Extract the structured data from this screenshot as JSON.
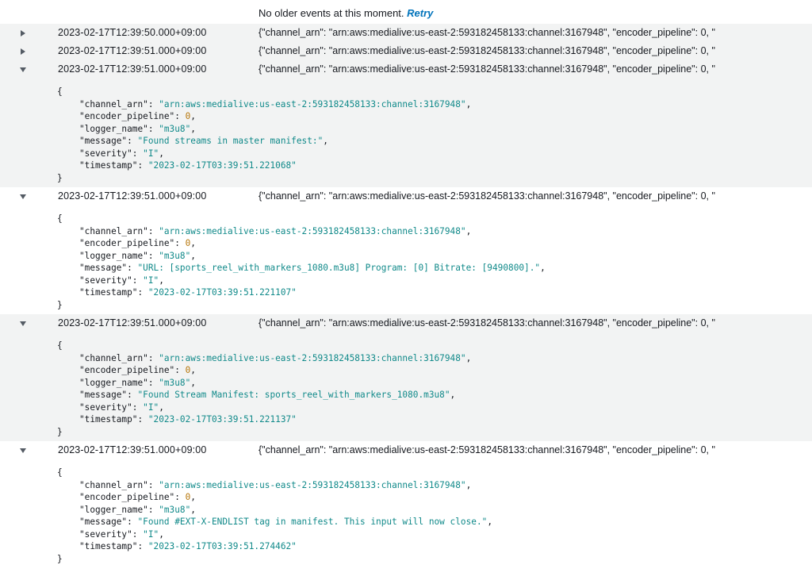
{
  "notice": {
    "text": "No older events at this moment.",
    "retry_label": "Retry"
  },
  "colors": {
    "row_alt_bg": "#f2f3f3",
    "string_value": "#118a8a",
    "number_value": "#b7770b",
    "link": "#0073bb"
  },
  "icons": {
    "collapsed": "caret-right-icon",
    "expanded": "caret-down-icon"
  },
  "events": [
    {
      "timestamp": "2023-02-17T12:39:50.000+09:00",
      "message": "{\"channel_arn\": \"arn:aws:medialive:us-east-2:593182458133:channel:3167948\", \"encoder_pipeline\": 0, \"",
      "expanded": false
    },
    {
      "timestamp": "2023-02-17T12:39:51.000+09:00",
      "message": "{\"channel_arn\": \"arn:aws:medialive:us-east-2:593182458133:channel:3167948\", \"encoder_pipeline\": 0, \"",
      "expanded": false
    },
    {
      "timestamp": "2023-02-17T12:39:51.000+09:00",
      "message": "{\"channel_arn\": \"arn:aws:medialive:us-east-2:593182458133:channel:3167948\", \"encoder_pipeline\": 0, \"",
      "expanded": true,
      "json": {
        "open": "{",
        "close": "}",
        "fields": [
          {
            "key": "\"channel_arn\"",
            "value": "\"arn:aws:medialive:us-east-2:593182458133:channel:3167948\"",
            "type": "string"
          },
          {
            "key": "\"encoder_pipeline\"",
            "value": "0",
            "type": "number"
          },
          {
            "key": "\"logger_name\"",
            "value": "\"m3u8\"",
            "type": "string"
          },
          {
            "key": "\"message\"",
            "value": "\"Found streams in master manifest:\"",
            "type": "string"
          },
          {
            "key": "\"severity\"",
            "value": "\"I\"",
            "type": "string"
          },
          {
            "key": "\"timestamp\"",
            "value": "\"2023-02-17T03:39:51.221068\"",
            "type": "string",
            "last": true
          }
        ]
      }
    },
    {
      "timestamp": "2023-02-17T12:39:51.000+09:00",
      "message": "{\"channel_arn\": \"arn:aws:medialive:us-east-2:593182458133:channel:3167948\", \"encoder_pipeline\": 0, \"",
      "expanded": true,
      "json": {
        "open": "{",
        "close": "}",
        "fields": [
          {
            "key": "\"channel_arn\"",
            "value": "\"arn:aws:medialive:us-east-2:593182458133:channel:3167948\"",
            "type": "string"
          },
          {
            "key": "\"encoder_pipeline\"",
            "value": "0",
            "type": "number"
          },
          {
            "key": "\"logger_name\"",
            "value": "\"m3u8\"",
            "type": "string"
          },
          {
            "key": "\"message\"",
            "value": "\"URL: [sports_reel_with_markers_1080.m3u8] Program: [0] Bitrate: [9490800].\"",
            "type": "string"
          },
          {
            "key": "\"severity\"",
            "value": "\"I\"",
            "type": "string"
          },
          {
            "key": "\"timestamp\"",
            "value": "\"2023-02-17T03:39:51.221107\"",
            "type": "string",
            "last": true
          }
        ]
      }
    },
    {
      "timestamp": "2023-02-17T12:39:51.000+09:00",
      "message": "{\"channel_arn\": \"arn:aws:medialive:us-east-2:593182458133:channel:3167948\", \"encoder_pipeline\": 0, \"",
      "expanded": true,
      "json": {
        "open": "{",
        "close": "}",
        "fields": [
          {
            "key": "\"channel_arn\"",
            "value": "\"arn:aws:medialive:us-east-2:593182458133:channel:3167948\"",
            "type": "string"
          },
          {
            "key": "\"encoder_pipeline\"",
            "value": "0",
            "type": "number"
          },
          {
            "key": "\"logger_name\"",
            "value": "\"m3u8\"",
            "type": "string"
          },
          {
            "key": "\"message\"",
            "value": "\"Found Stream Manifest: sports_reel_with_markers_1080.m3u8\"",
            "type": "string"
          },
          {
            "key": "\"severity\"",
            "value": "\"I\"",
            "type": "string"
          },
          {
            "key": "\"timestamp\"",
            "value": "\"2023-02-17T03:39:51.221137\"",
            "type": "string",
            "last": true
          }
        ]
      }
    },
    {
      "timestamp": "2023-02-17T12:39:51.000+09:00",
      "message": "{\"channel_arn\": \"arn:aws:medialive:us-east-2:593182458133:channel:3167948\", \"encoder_pipeline\": 0, \"",
      "expanded": true,
      "json": {
        "open": "{",
        "close": "}",
        "fields": [
          {
            "key": "\"channel_arn\"",
            "value": "\"arn:aws:medialive:us-east-2:593182458133:channel:3167948\"",
            "type": "string"
          },
          {
            "key": "\"encoder_pipeline\"",
            "value": "0",
            "type": "number"
          },
          {
            "key": "\"logger_name\"",
            "value": "\"m3u8\"",
            "type": "string"
          },
          {
            "key": "\"message\"",
            "value": "\"Found #EXT-X-ENDLIST tag in manifest. This input will now close.\"",
            "type": "string"
          },
          {
            "key": "\"severity\"",
            "value": "\"I\"",
            "type": "string"
          },
          {
            "key": "\"timestamp\"",
            "value": "\"2023-02-17T03:39:51.274462\"",
            "type": "string",
            "last": true
          }
        ]
      }
    }
  ]
}
